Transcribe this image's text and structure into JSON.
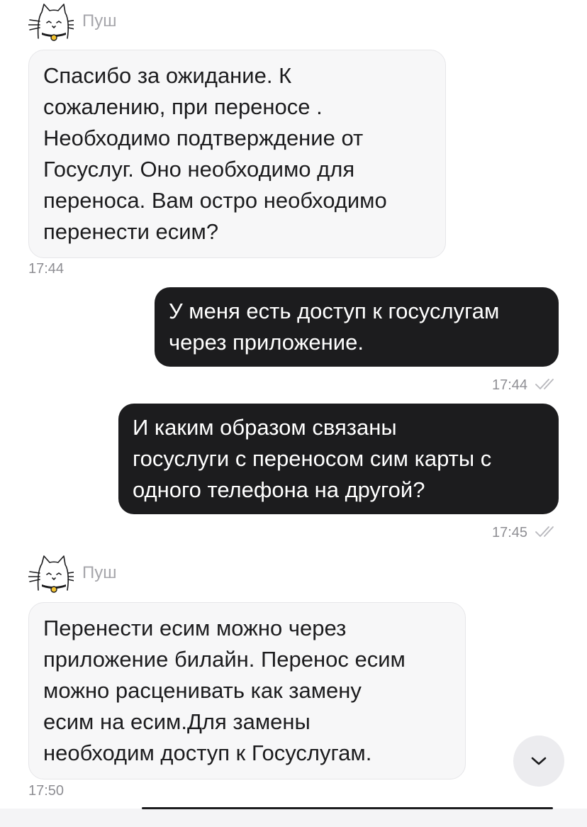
{
  "chat": {
    "messages": [
      {
        "direction": "incoming",
        "sender": "Пуш",
        "avatar_icon": "cat-avatar-icon",
        "lines": [
          "Спасибо за ожидание. К",
          "сожалению, при переносе .",
          "Необходимо подтверждение от",
          "Госуслуг. Оно необходимо для",
          "переноса. Вам остро необходимо",
          "перенести есим?"
        ],
        "time": "17:44"
      },
      {
        "direction": "outgoing",
        "lines": [
          "У меня есть доступ к госуслугам",
          "через приложение."
        ],
        "time": "17:44",
        "status_icon": "double-check-icon"
      },
      {
        "direction": "outgoing",
        "lines": [
          "И каким образом связаны",
          "госуслуги с переносом сим карты с",
          "одного телефона на другой?"
        ],
        "time": "17:45",
        "status_icon": "double-check-icon"
      },
      {
        "direction": "incoming",
        "sender": "Пуш",
        "avatar_icon": "cat-avatar-icon",
        "lines": [
          "Перенести есим можно через",
          "приложение билайн. Перенос есим",
          "можно расценивать как замену",
          "есим на есим.Для замены",
          "необходим доступ к Госуслугам."
        ],
        "time": "17:50"
      }
    ]
  },
  "controls": {
    "scroll_down_icon": "chevron-down-icon"
  },
  "colors": {
    "incoming_bubble": "#f7f7f8",
    "outgoing_bubble": "#1c1c1e",
    "timestamp": "#8e8e93",
    "sender_name": "#a6a6ab",
    "collar": "#1c1c1e",
    "bell": "#f4c430"
  }
}
